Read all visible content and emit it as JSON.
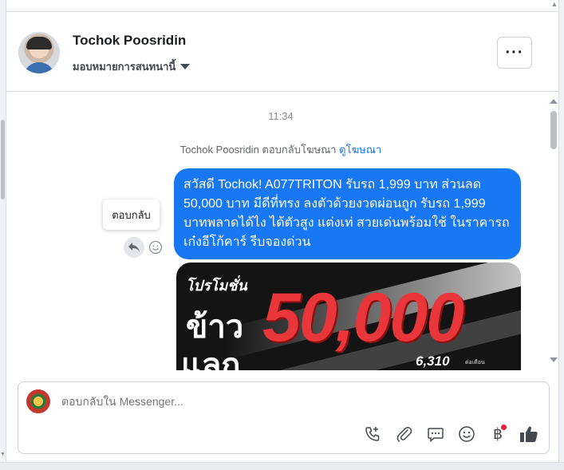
{
  "header": {
    "contact_name": "Tochok Poosridin",
    "assign_label": "มอบหมายการสนทนานี้",
    "more_label": "···"
  },
  "conversation": {
    "timestamp": "11:34",
    "reply_note_prefix": "Tochok Poosridin ตอบกลับโฆษณา ",
    "reply_note_link": "ดูโฆษณา",
    "message_text": "สวัสดี Tochok! A077TRITON รับรถ 1,999 บาท ส่วนลด 50,000 บาท มีดีที่ทรง ลงตัวด้วยงวดผ่อนถูก รับรถ 1,999 บาทพลาดได้ไง ได้ตัวสูง แต่งเท่ สวยเด่นพร้อมใช้  ในราคารถเก๋งอีโก้คาร์ รีบจองด่วน",
    "reply_tooltip": "ตอบกลับ",
    "promo": {
      "title": "โปรโมชั่น",
      "word1": "ข้าว",
      "word2": "แลก",
      "amount": "50,000",
      "small_text": "6,310",
      "tiny_text": "ต่อเดือน"
    }
  },
  "composer": {
    "placeholder": "ตอบกลับใน Messenger..."
  },
  "colors": {
    "accent": "#1877f2",
    "badge": "#e41e3f",
    "promo_red": "#e8363a"
  },
  "icons": [
    "more-icon",
    "caret-down-icon",
    "reply-icon",
    "emoji-icon",
    "call-add-icon",
    "paperclip-icon",
    "saved-reply-icon",
    "smile-icon",
    "baht-icon",
    "thumbs-up-icon"
  ]
}
